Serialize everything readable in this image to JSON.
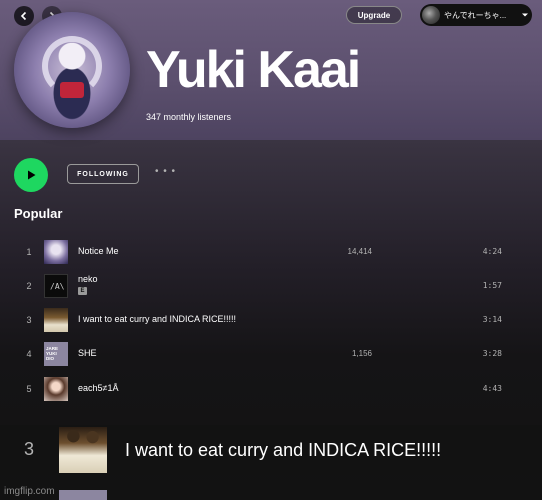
{
  "header": {
    "upgrade_label": "Upgrade",
    "user_name": "やんでれーちゃ..."
  },
  "artist": {
    "name": "Yuki Kaai",
    "listeners": "347 monthly listeners"
  },
  "actions": {
    "following_label": "FOLLOWING",
    "more_label": "• • •"
  },
  "section": {
    "popular_title": "Popular"
  },
  "tracks": [
    {
      "num": "1",
      "title": "Notice Me",
      "plays": "14,414",
      "duration": "4:24",
      "explicit": false
    },
    {
      "num": "2",
      "title": "neko",
      "plays": "",
      "duration": "1:57",
      "explicit": true,
      "explicit_label": "E",
      "cover_text": "/A\\"
    },
    {
      "num": "3",
      "title": "I want to eat curry and INDICA RICE!!!!!",
      "plays": "",
      "duration": "3:14",
      "explicit": false
    },
    {
      "num": "4",
      "title": "SHE",
      "plays": "1,156",
      "duration": "3:28",
      "explicit": false,
      "cover_text": "JARE\nYUKI\nDIO"
    },
    {
      "num": "5",
      "title": "each5≠1Å",
      "plays": "",
      "duration": "4:43",
      "explicit": false
    }
  ],
  "zoomed_track": {
    "num": "3",
    "title": "I want to eat curry and INDICA RICE!!!!!"
  },
  "watermark": "imgflip.com",
  "colors": {
    "accent_green": "#1ed760",
    "background": "#121212",
    "hero": "#6a5c7c"
  },
  "icons": {
    "back": "chevron-left-icon",
    "forward": "chevron-right-icon",
    "play": "play-icon",
    "dropdown": "chevron-down-icon"
  }
}
